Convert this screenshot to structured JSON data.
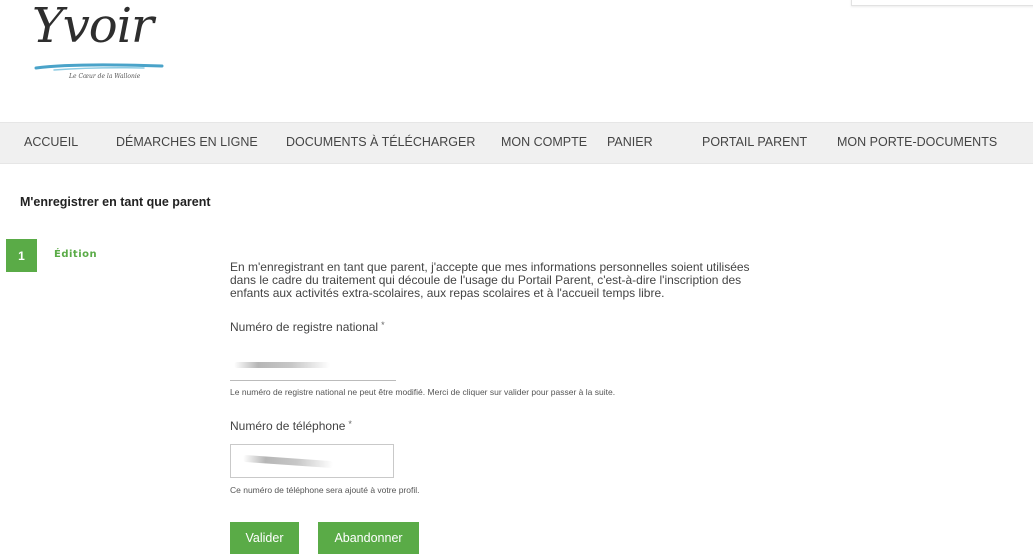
{
  "brand": {
    "logo_text": "Yvoir",
    "tagline": "Le Cœur de la Wallonie"
  },
  "nav": {
    "items": [
      {
        "label": "ACCUEIL"
      },
      {
        "label": "DÉMARCHES EN LIGNE"
      },
      {
        "label": "DOCUMENTS À TÉLÉCHARGER"
      },
      {
        "label": "MON COMPTE"
      },
      {
        "label": "PANIER"
      },
      {
        "label": "PORTAIL PARENT"
      },
      {
        "label": "MON PORTE-DOCUMENTS"
      }
    ]
  },
  "page": {
    "title": "M'enregistrer en tant que parent"
  },
  "step": {
    "number": "1",
    "label": "Édition"
  },
  "form": {
    "intro_lines": [
      "En m'enregistrant en tant que parent, j'accepte que mes informations personnelles soient utilisées",
      "dans le cadre du traitement qui découle de l'usage du Portail Parent, c'est-à-dire l'inscription des",
      "enfants aux activités extra-scolaires, aux repas scolaires et à l'accueil temps libre."
    ],
    "nrn": {
      "label": "Numéro de registre national",
      "required_mark": "*",
      "help": "Le numéro de registre national ne peut être modifié. Merci de cliquer sur valider pour passer à la suite."
    },
    "phone": {
      "label": "Numéro de téléphone",
      "required_mark": "*",
      "help": "Ce numéro de téléphone sera ajouté à votre profil."
    },
    "buttons": {
      "submit": "Valider",
      "cancel": "Abandonner"
    }
  },
  "colors": {
    "accent": "#5aab47",
    "nav_bg": "#f0f0f0",
    "logo_swoosh": "#4aa3c9"
  }
}
